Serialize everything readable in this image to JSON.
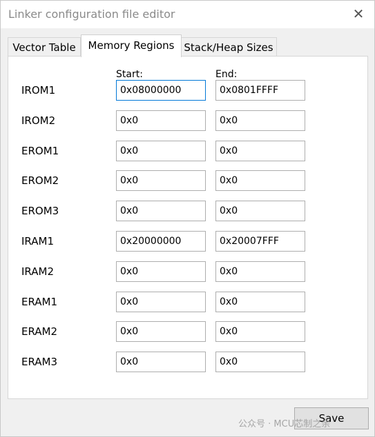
{
  "window": {
    "title": "Linker configuration file editor",
    "close_glyph": "✕"
  },
  "tabs": [
    {
      "label": "Vector Table",
      "active": false
    },
    {
      "label": "Memory Regions",
      "active": true
    },
    {
      "label": "Stack/Heap Sizes",
      "active": false
    }
  ],
  "columns": {
    "start": "Start:",
    "end": "End:"
  },
  "regions": [
    {
      "name": "IROM1",
      "start": "0x08000000",
      "end": "0x0801FFFF"
    },
    {
      "name": "IROM2",
      "start": "0x0",
      "end": "0x0"
    },
    {
      "name": "EROM1",
      "start": "0x0",
      "end": "0x0"
    },
    {
      "name": "EROM2",
      "start": "0x0",
      "end": "0x0"
    },
    {
      "name": "EROM3",
      "start": "0x0",
      "end": "0x0"
    },
    {
      "name": "IRAM1",
      "start": "0x20000000",
      "end": "0x20007FFF"
    },
    {
      "name": "IRAM2",
      "start": "0x0",
      "end": "0x0"
    },
    {
      "name": "ERAM1",
      "start": "0x0",
      "end": "0x0"
    },
    {
      "name": "ERAM2",
      "start": "0x0",
      "end": "0x0"
    },
    {
      "name": "ERAM3",
      "start": "0x0",
      "end": "0x0"
    }
  ],
  "footer": {
    "save_label": "Save"
  },
  "watermark": "公众号 · MCU芯制之余"
}
